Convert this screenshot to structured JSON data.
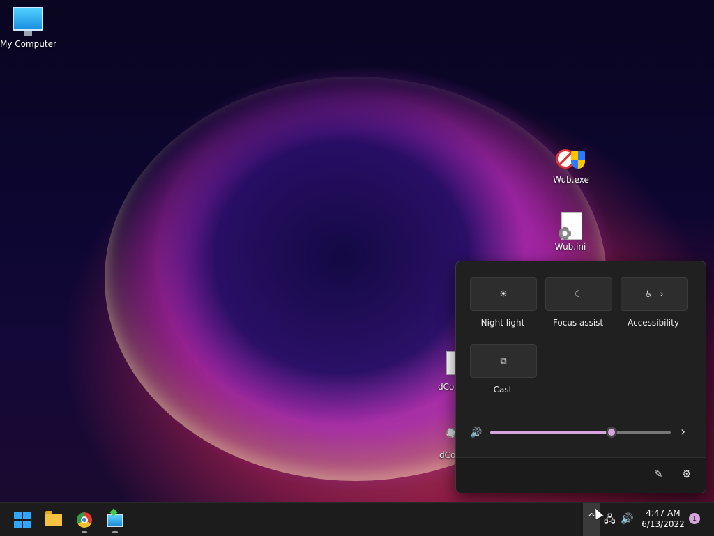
{
  "desktop": {
    "icons": [
      {
        "label": "My Computer",
        "icon": "computer-icon"
      },
      {
        "label": "Wub.exe",
        "icon": "wub-exe-icon"
      },
      {
        "label": "Wub.ini",
        "icon": "ini-file-icon"
      },
      {
        "label": "dCo",
        "icon": "text-file-icon"
      },
      {
        "label": "dCo",
        "icon": "ini-file-icon"
      }
    ]
  },
  "quick_settings": {
    "tiles": [
      {
        "label": "Night light",
        "icon": "night-light-icon",
        "glyph": "☀"
      },
      {
        "label": "Focus assist",
        "icon": "moon-icon",
        "glyph": "☾"
      },
      {
        "label": "Accessibility",
        "icon": "accessibility-icon",
        "glyph": "♿",
        "chevron": "›"
      },
      {
        "label": "Cast",
        "icon": "cast-icon",
        "glyph": "⧉"
      }
    ],
    "volume": {
      "icon": "speaker-icon",
      "glyph": "🔊",
      "level": 0.67,
      "chevron": "›"
    },
    "footer": {
      "edit_glyph": "✎",
      "settings_glyph": "⚙"
    },
    "accent_color": "#d7a5dd"
  },
  "taskbar": {
    "apps": [
      {
        "name": "start",
        "icon": "windows-logo-icon"
      },
      {
        "name": "file-explorer",
        "icon": "folder-icon"
      },
      {
        "name": "chrome",
        "icon": "chrome-icon"
      },
      {
        "name": "remote-app",
        "icon": "monitor-app-icon"
      }
    ],
    "tray": {
      "chevron": "^",
      "network_glyph": "🖧",
      "volume_glyph": "🔊"
    },
    "clock": {
      "time": "4:47 AM",
      "date": "6/13/2022"
    },
    "notification_count": "1"
  }
}
